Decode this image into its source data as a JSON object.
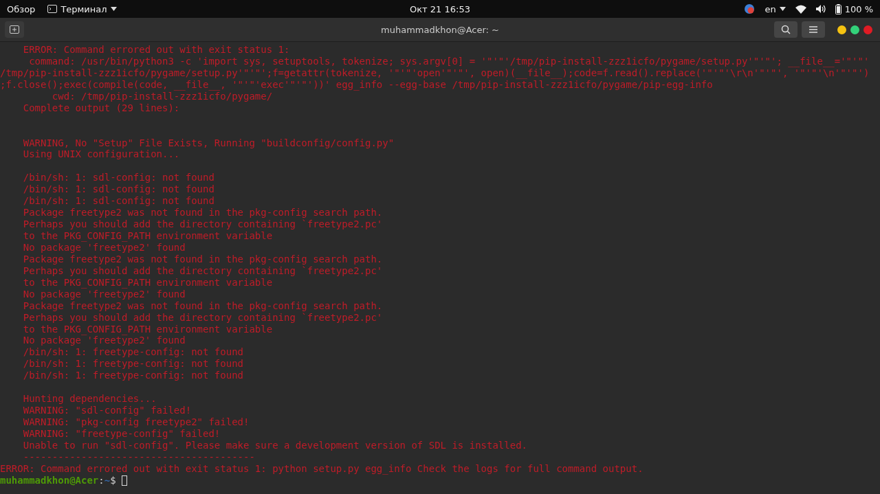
{
  "top_bar": {
    "activities": "Обзор",
    "app_menu": "Терминал",
    "clock": "Окт 21  16:53",
    "language": "en",
    "battery": "100 %"
  },
  "window": {
    "title": "muhammadkhon@Acer: ~"
  },
  "terminal": {
    "lines": [
      {
        "kind": "error",
        "text": "    ERROR: Command errored out with exit status 1:"
      },
      {
        "kind": "error",
        "text": "     command: /usr/bin/python3 -c 'import sys, setuptools, tokenize; sys.argv[0] = '\"'\"'/tmp/pip-install-zzz1icfo/pygame/setup.py'\"'\"'; __file__='\"'\"'"
      },
      {
        "kind": "error",
        "text": "/tmp/pip-install-zzz1icfo/pygame/setup.py'\"'\"';f=getattr(tokenize, '\"'\"'open'\"'\"', open)(__file__);code=f.read().replace('\"'\"'\\r\\n'\"'\"', '\"'\"'\\n'\"'\"')"
      },
      {
        "kind": "error",
        "text": ";f.close();exec(compile(code, __file__, '\"'\"'exec'\"'\"'))' egg_info --egg-base /tmp/pip-install-zzz1icfo/pygame/pip-egg-info"
      },
      {
        "kind": "error",
        "text": "         cwd: /tmp/pip-install-zzz1icfo/pygame/"
      },
      {
        "kind": "error",
        "text": "    Complete output (29 lines):"
      },
      {
        "kind": "blank"
      },
      {
        "kind": "blank"
      },
      {
        "kind": "error",
        "text": "    WARNING, No \"Setup\" File Exists, Running \"buildconfig/config.py\""
      },
      {
        "kind": "error",
        "text": "    Using UNIX configuration..."
      },
      {
        "kind": "blank"
      },
      {
        "kind": "error",
        "text": "    /bin/sh: 1: sdl-config: not found"
      },
      {
        "kind": "error",
        "text": "    /bin/sh: 1: sdl-config: not found"
      },
      {
        "kind": "error",
        "text": "    /bin/sh: 1: sdl-config: not found"
      },
      {
        "kind": "error",
        "text": "    Package freetype2 was not found in the pkg-config search path."
      },
      {
        "kind": "error",
        "text": "    Perhaps you should add the directory containing `freetype2.pc'"
      },
      {
        "kind": "error",
        "text": "    to the PKG_CONFIG_PATH environment variable"
      },
      {
        "kind": "error",
        "text": "    No package 'freetype2' found"
      },
      {
        "kind": "error",
        "text": "    Package freetype2 was not found in the pkg-config search path."
      },
      {
        "kind": "error",
        "text": "    Perhaps you should add the directory containing `freetype2.pc'"
      },
      {
        "kind": "error",
        "text": "    to the PKG_CONFIG_PATH environment variable"
      },
      {
        "kind": "error",
        "text": "    No package 'freetype2' found"
      },
      {
        "kind": "error",
        "text": "    Package freetype2 was not found in the pkg-config search path."
      },
      {
        "kind": "error",
        "text": "    Perhaps you should add the directory containing `freetype2.pc'"
      },
      {
        "kind": "error",
        "text": "    to the PKG_CONFIG_PATH environment variable"
      },
      {
        "kind": "error",
        "text": "    No package 'freetype2' found"
      },
      {
        "kind": "error",
        "text": "    /bin/sh: 1: freetype-config: not found"
      },
      {
        "kind": "error",
        "text": "    /bin/sh: 1: freetype-config: not found"
      },
      {
        "kind": "error",
        "text": "    /bin/sh: 1: freetype-config: not found"
      },
      {
        "kind": "blank"
      },
      {
        "kind": "error",
        "text": "    Hunting dependencies..."
      },
      {
        "kind": "error",
        "text": "    WARNING: \"sdl-config\" failed!"
      },
      {
        "kind": "error",
        "text": "    WARNING: \"pkg-config freetype2\" failed!"
      },
      {
        "kind": "error",
        "text": "    WARNING: \"freetype-config\" failed!"
      },
      {
        "kind": "error",
        "text": "    Unable to run \"sdl-config\". Please make sure a development version of SDL is installed."
      },
      {
        "kind": "error",
        "text": "    ----------------------------------------"
      },
      {
        "kind": "error",
        "text": "ERROR: Command errored out with exit status 1: python setup.py egg_info Check the logs for full command output."
      }
    ],
    "prompt": {
      "user_host": "muhammadkhon@Acer",
      "separator": ":",
      "path": "~",
      "symbol": "$"
    }
  }
}
